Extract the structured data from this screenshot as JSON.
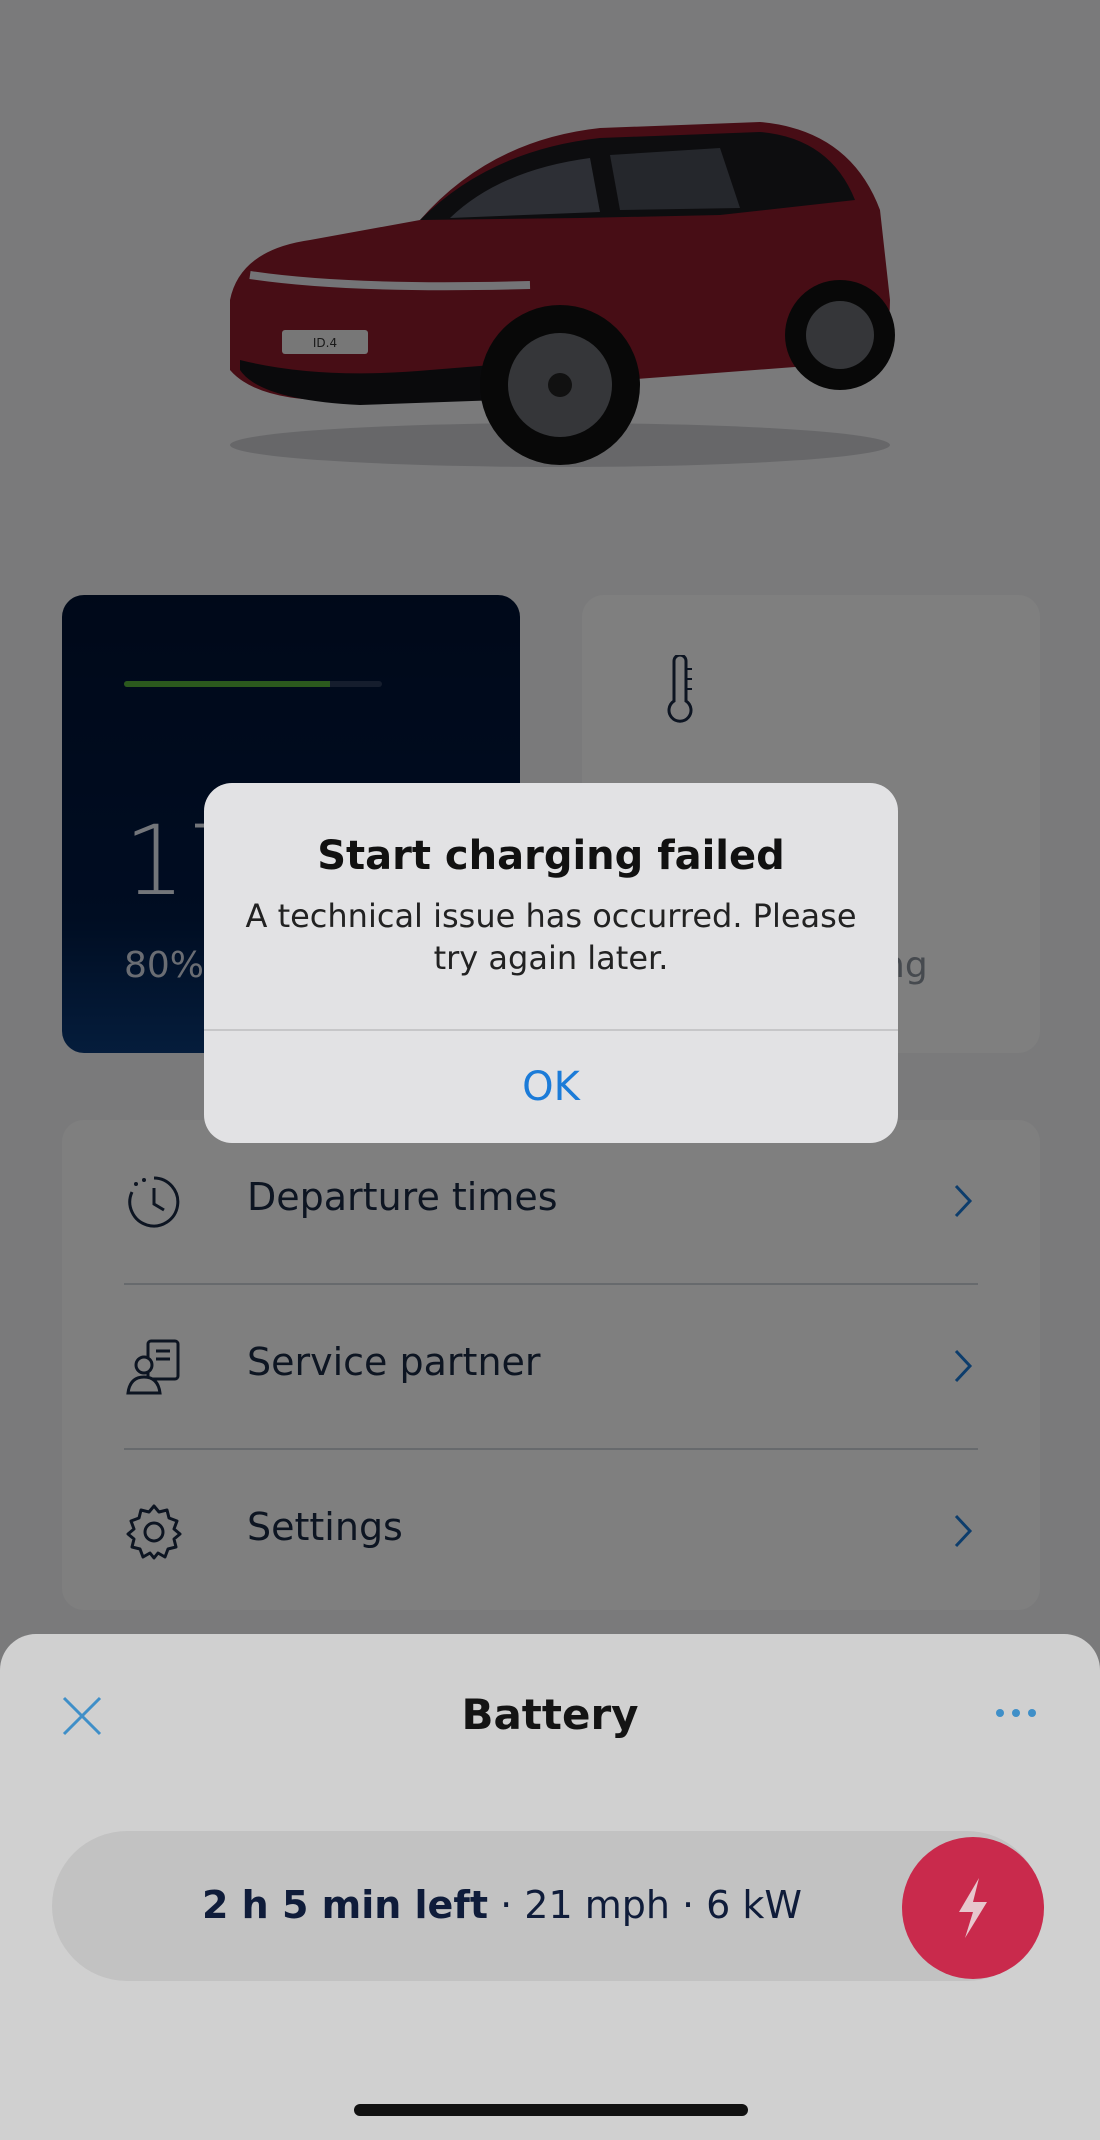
{
  "car": {
    "plate_text": "ID.4"
  },
  "battery_tile": {
    "range_partial": "17",
    "charge_percent_partial": "80%",
    "progress_fraction": 0.8
  },
  "climate_tile": {
    "status_partial": "ng"
  },
  "list": {
    "items": [
      {
        "label": "Departure times",
        "icon": "clock-icon"
      },
      {
        "label": "Service partner",
        "icon": "service-partner-icon"
      },
      {
        "label": "Settings",
        "icon": "gear-icon"
      }
    ]
  },
  "sheet": {
    "title": "Battery",
    "charge_status_bold": "2 h 5 min left",
    "charge_status_rest": " · 21 mph · 6 kW"
  },
  "alert": {
    "title": "Start charging failed",
    "message": "A technical issue has occurred. Please try again later.",
    "ok_label": "OK"
  },
  "colors": {
    "accent_blue": "#1b7bd8",
    "charge_button": "#c92a4c",
    "battery_tile_bg": "#001233",
    "progress_green": "#57b33a"
  }
}
